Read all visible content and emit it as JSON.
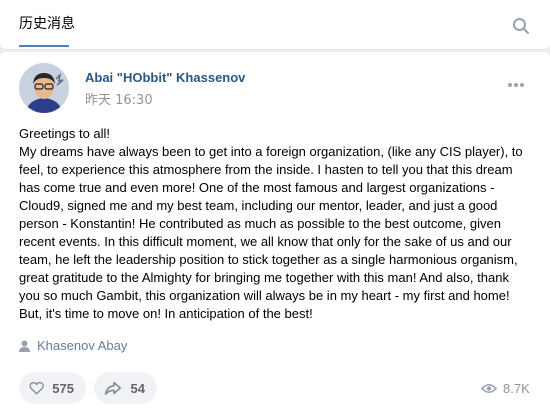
{
  "header": {
    "tab_label": "历史消息",
    "search_icon": "search-icon"
  },
  "post": {
    "author": "Abai \"HObbit\" Khassenov",
    "time": "昨天 16:30",
    "text": "Greetings to all!\nMy dreams have always been to get into a foreign organization, (like any CIS player), to\nfeel, to experience this atmosphere from the inside. I hasten to tell you that this dream\nhas come true and even more! One of the most famous and largest organizations -\nCloud9, signed me and my best team, including our mentor, leader, and just a good\nperson - Konstantin! He contributed as much as possible to the best outcome, given\nrecent events. In this difficult moment, we all know that only for the sake of us and our\nteam, he left the leadership position to stick together as a single harmonious organism,\ngreat gratitude to the Almighty for bringing me together with this man! And also, thank\nyou so much Gambit, this organization will always be in my heart - my first and home!\nBut, it's time to move on! In anticipation of the best!",
    "signer": "Khasenov Abay",
    "likes": "575",
    "shares": "54",
    "views": "8.7K"
  },
  "colors": {
    "link": "#2a5885",
    "accent": "#5181b8",
    "muted": "#939393"
  }
}
